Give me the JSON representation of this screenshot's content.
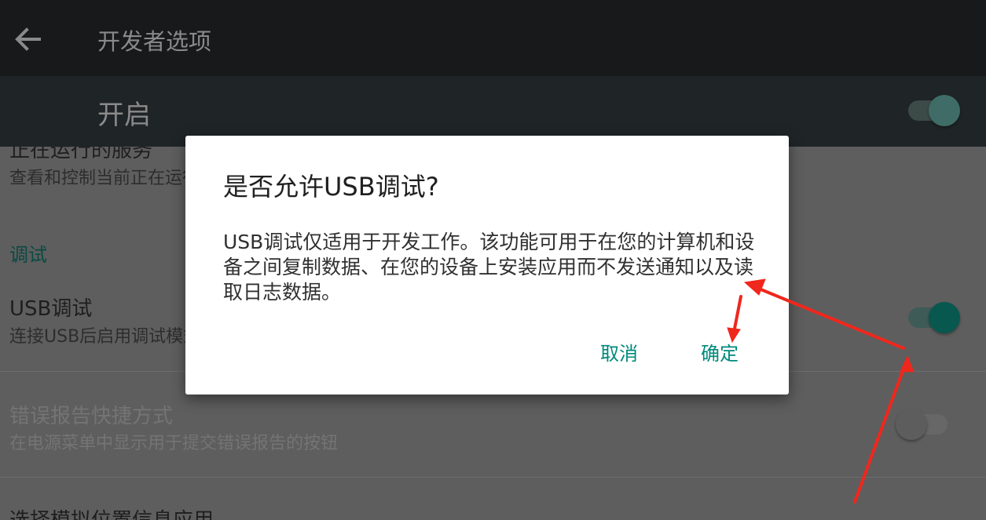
{
  "appbar": {
    "title": "开发者选项",
    "back_icon": "arrow-back-icon"
  },
  "master_switch": {
    "label": "开启",
    "state": "on"
  },
  "rows": {
    "running_services": {
      "title": "正在运行的服务",
      "subtitle": "查看和控制当前正在运行的服务"
    },
    "debug_section": "调试",
    "usb_debug": {
      "title": "USB调试",
      "subtitle": "连接USB后启用调试模式",
      "state": "on"
    },
    "bug_report": {
      "title": "错误报告快捷方式",
      "subtitle": "在电源菜单中显示用于提交错误报告的按钮",
      "state": "off"
    },
    "mock_location": {
      "title": "选择模拟位置信息应用"
    }
  },
  "dialog": {
    "title": "是否允许USB调试?",
    "message": "USB调试仅适用于开发工作。该功能可用于在您的计算机和设备之间复制数据、在您的设备上安装应用而不发送通知以及读取日志数据。",
    "cancel_label": "取消",
    "ok_label": "确定"
  },
  "colors": {
    "accent": "#00897b",
    "switch_on_thumb": "#08584f",
    "annotation": "#f0271c"
  }
}
